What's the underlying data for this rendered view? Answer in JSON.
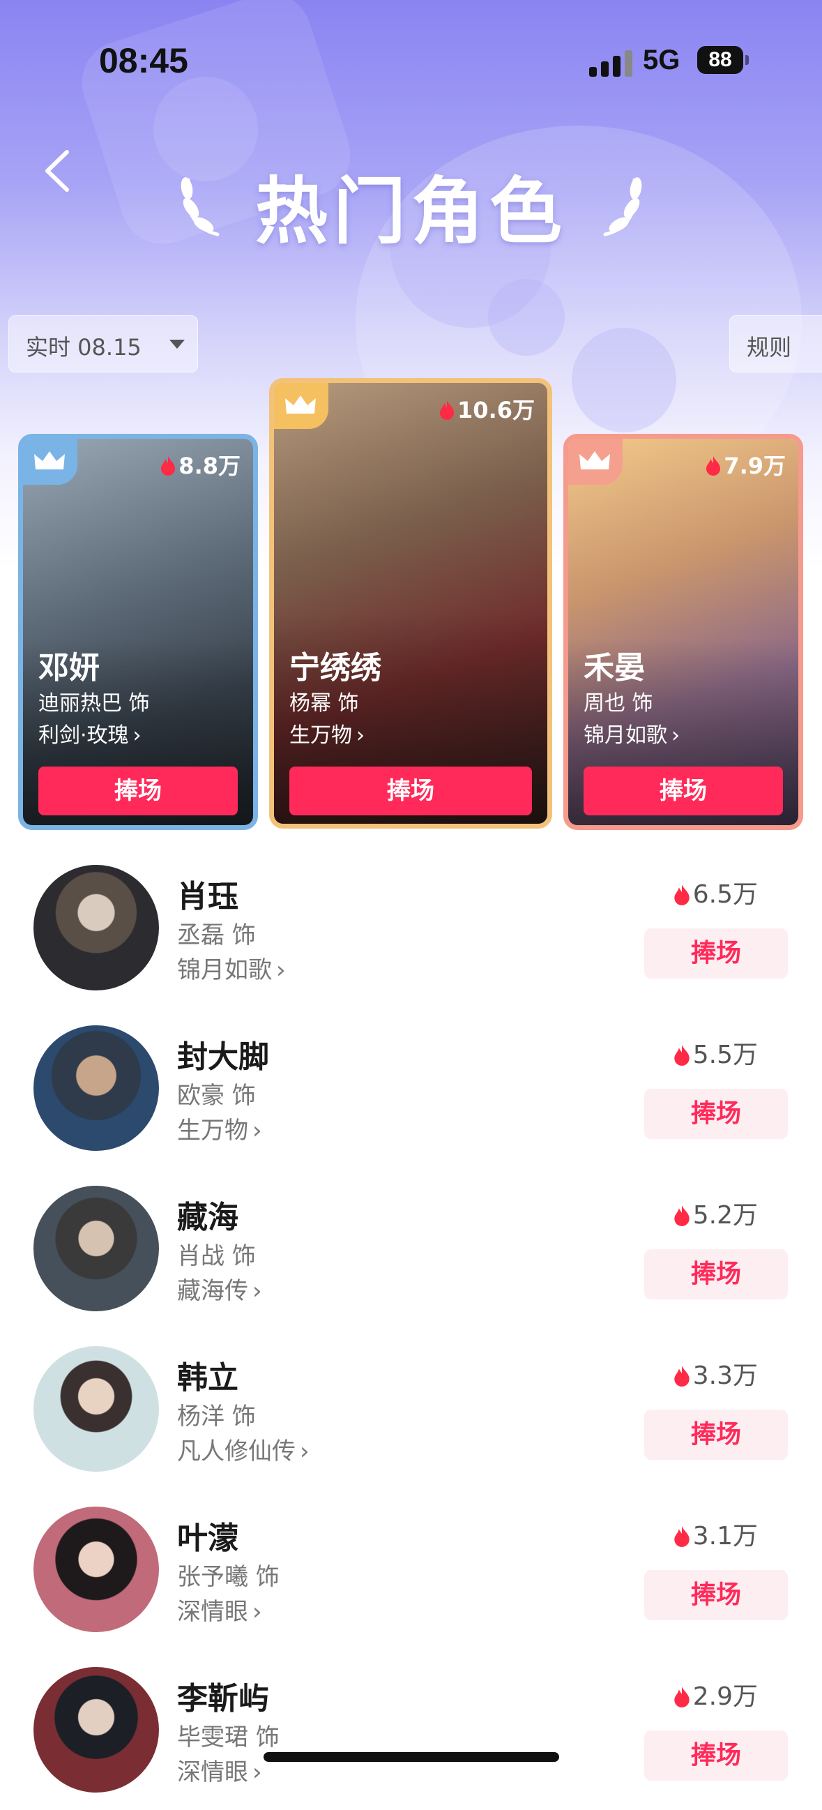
{
  "status_bar": {
    "time": "08:45",
    "network": "5G",
    "battery": "88"
  },
  "header": {
    "title": "热门角色"
  },
  "filters": {
    "date_label": "实时 08.15",
    "rules_label": "规则"
  },
  "top_cards": [
    {
      "heat": "8.8万",
      "role": "邓妍",
      "actor": "迪丽热巴 饰",
      "show": "利剑·玫瑰",
      "cheer": "捧场"
    },
    {
      "heat": "10.6万",
      "role": "宁绣绣",
      "actor": "杨幂 饰",
      "show": "生万物",
      "cheer": "捧场"
    },
    {
      "heat": "7.9万",
      "role": "禾晏",
      "actor": "周也 饰",
      "show": "锦月如歌",
      "cheer": "捧场"
    }
  ],
  "ranking": [
    {
      "role": "肖珏",
      "actor": "丞磊 饰",
      "show": "锦月如歌",
      "heat": "6.5万",
      "cheer": "捧场"
    },
    {
      "role": "封大脚",
      "actor": "欧豪 饰",
      "show": "生万物",
      "heat": "5.5万",
      "cheer": "捧场"
    },
    {
      "role": "藏海",
      "actor": "肖战 饰",
      "show": "藏海传",
      "heat": "5.2万",
      "cheer": "捧场"
    },
    {
      "role": "韩立",
      "actor": "杨洋 饰",
      "show": "凡人修仙传",
      "heat": "3.3万",
      "cheer": "捧场"
    },
    {
      "role": "叶濛",
      "actor": "张予曦 饰",
      "show": "深情眼",
      "heat": "3.1万",
      "cheer": "捧场"
    },
    {
      "role": "李靳屿",
      "actor": "毕雯珺 饰",
      "show": "深情眼",
      "heat": "2.9万",
      "cheer": "捧场"
    }
  ],
  "icons": {
    "back": "back-chevron-icon",
    "flame": "flame-icon",
    "crown": "crown-icon",
    "laurel": "laurel-icon",
    "caret": "caret-down-icon"
  },
  "colors": {
    "accent": "#ff2a59",
    "cheer_bg_light": "#fdeef2",
    "gold_frame": "#f3c27a",
    "blue_frame": "#7ab4e6",
    "pink_frame": "#f59a8c"
  }
}
